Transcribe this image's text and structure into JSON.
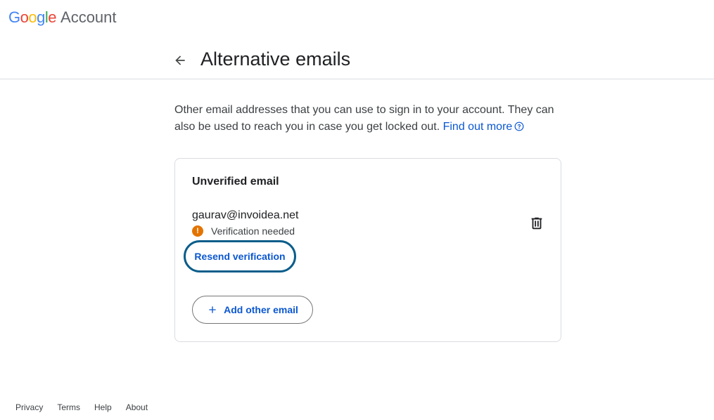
{
  "brand": {
    "logo_letters": [
      "G",
      "o",
      "o",
      "g",
      "l",
      "e"
    ],
    "product": "Account",
    "colors": {
      "blue": "#4285f4",
      "red": "#ea4335",
      "yellow": "#fbbc05",
      "green": "#34a853"
    }
  },
  "header": {
    "back_icon": "arrow-left-icon",
    "title": "Alternative emails"
  },
  "description": {
    "text": "Other email addresses that you can use to sign in to your account. They can also be used to reach you in case you get locked out.",
    "link_label": "Find out more",
    "link_icon": "help-circle-icon"
  },
  "card": {
    "title": "Unverified email",
    "email": "gaurav@invoidea.net",
    "status_icon": "warning-icon",
    "status_glyph": "!",
    "status_text": "Verification needed",
    "status_color": "#e37400",
    "delete_icon": "trash-icon",
    "resend_label": "Resend verification",
    "add_icon": "plus-icon",
    "add_label": "Add other email"
  },
  "footer": {
    "links": [
      "Privacy",
      "Terms",
      "Help",
      "About"
    ]
  },
  "accent_color": "#0b57d0"
}
